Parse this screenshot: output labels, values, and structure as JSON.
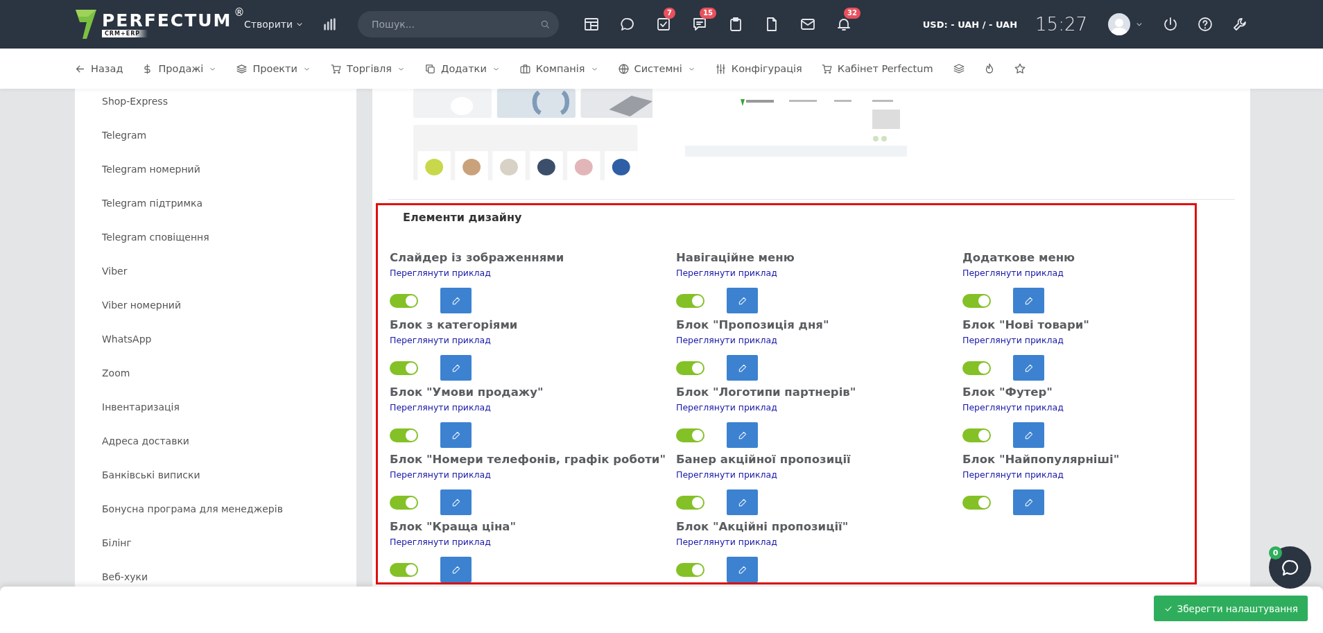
{
  "topbar": {
    "logo": {
      "name": "PERFECTUM",
      "mark": "®",
      "sub": "CRM+ERP"
    },
    "create_menu": "Створити",
    "search": {
      "placeholder": "Пошук..."
    },
    "icons": [
      {
        "kind": "layout"
      },
      {
        "kind": "chat"
      },
      {
        "kind": "tasks",
        "badge": "7"
      },
      {
        "kind": "message",
        "badge": "15"
      },
      {
        "kind": "clipboard"
      },
      {
        "kind": "file"
      },
      {
        "kind": "mail"
      },
      {
        "kind": "bell",
        "badge": "32"
      }
    ],
    "currency": "USD: - UAH / - UAH",
    "time": "15:27"
  },
  "navbar": {
    "items": [
      {
        "kind": "back",
        "label": "Назад",
        "dropdown": false
      },
      {
        "kind": "dollar",
        "label": "Продажі",
        "dropdown": true
      },
      {
        "kind": "layers",
        "label": "Проекти",
        "dropdown": true
      },
      {
        "kind": "cart",
        "label": "Торгівля",
        "dropdown": true
      },
      {
        "kind": "copy",
        "label": "Додатки",
        "dropdown": true
      },
      {
        "kind": "briefcase",
        "label": "Компанія",
        "dropdown": true
      },
      {
        "kind": "globe",
        "label": "Системні",
        "dropdown": true
      },
      {
        "kind": "sliders",
        "label": "Конфігурація",
        "dropdown": false
      },
      {
        "kind": "cart",
        "label": "Кабінет Perfectum",
        "dropdown": false
      }
    ]
  },
  "sidebar": {
    "items": [
      "Shop-Express",
      "Telegram",
      "Telegram номерний",
      "Telegram підтримка",
      "Telegram сповіщення",
      "Viber",
      "Viber номерний",
      "WhatsApp",
      "Zoom",
      "Інвентаризація",
      "Адреса доставки",
      "Банківські виписки",
      "Бонусна програма для менеджерів",
      "Білінг",
      "Веб-хуки"
    ]
  },
  "design_elements": {
    "title": "Елементи дизайну",
    "items": [
      {
        "title": "Слайдер із зображеннями",
        "link": "Переглянути приклад",
        "on": true
      },
      {
        "title": "Навігаційне меню",
        "link": "Переглянути приклад",
        "on": true
      },
      {
        "title": "Додаткове меню",
        "link": "Переглянути приклад",
        "on": true
      },
      {
        "title": "Блок з категоріями",
        "link": "Переглянути приклад",
        "on": true
      },
      {
        "title": "Блок \"Пропозиція дня\"",
        "link": "Переглянути приклад",
        "on": true
      },
      {
        "title": "Блок \"Нові товари\"",
        "link": "Переглянути приклад",
        "on": true
      },
      {
        "title": "Блок \"Умови продажу\"",
        "link": "Переглянути приклад",
        "on": true
      },
      {
        "title": "Блок \"Логотипи партнерів\"",
        "link": "Переглянути приклад",
        "on": true
      },
      {
        "title": "Блок \"Футер\"",
        "link": "Переглянути приклад",
        "on": true
      },
      {
        "title": "Блок \"Номери телефонів, графік роботи\"",
        "link": "Переглянути приклад",
        "on": true
      },
      {
        "title": "Банер акційної пропозиції",
        "link": "Переглянути приклад",
        "on": true
      },
      {
        "title": "Блок \"Найпопулярніші\"",
        "link": "Переглянути приклад",
        "on": true
      },
      {
        "title": "Блок \"Краща ціна\"",
        "link": "Переглянути приклад",
        "on": true
      },
      {
        "title": "Блок \"Акційні пропозиції\"",
        "link": "Переглянути приклад",
        "on": true
      }
    ]
  },
  "footer": {
    "save_button": "Зберегти налаштування"
  },
  "chat": {
    "badge": "0"
  }
}
